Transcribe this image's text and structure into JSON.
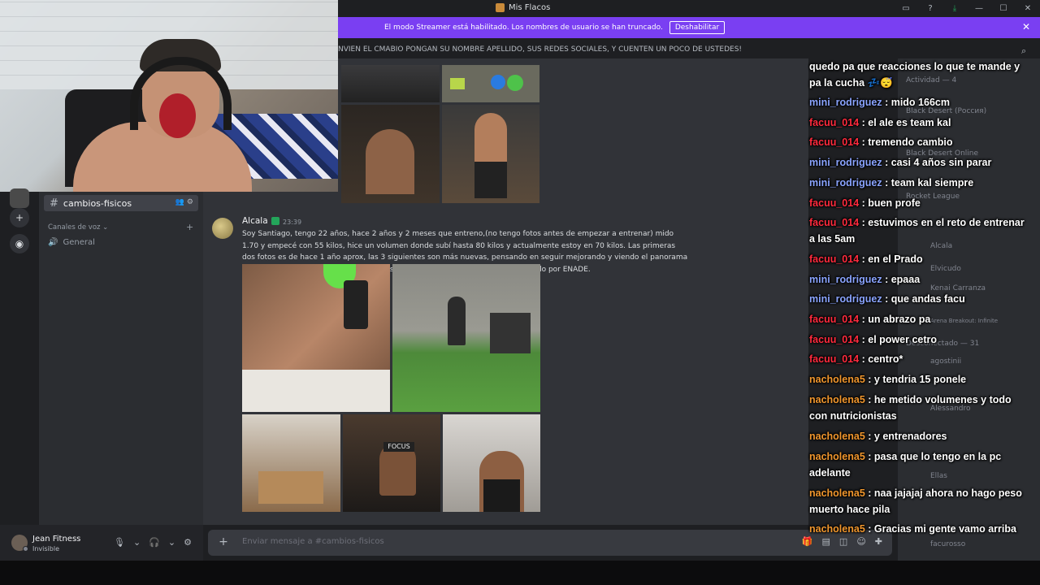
{
  "window": {
    "title": "Mis Flacos",
    "controls": [
      "inbox-icon",
      "help-icon",
      "download-icon",
      "minimize",
      "maximize",
      "close"
    ]
  },
  "streamer_banner": {
    "text": "El modo Streamer está habilitado. Los nombres de usuario se han truncado.",
    "button": "Deshabilitar"
  },
  "channel_topic": "NVIEN EL CMABIO PONGAN SU NOMBRE APELLIDO, SUS REDES SOCIALES, Y CUENTEN UN POCO DE USTEDES!",
  "sidebar": {
    "active_channel": "cambios-fisicos",
    "voice_header": "Canales de voz",
    "voice_channel": "General"
  },
  "user_panel": {
    "name": "Jean Fitness",
    "status": "Invisible"
  },
  "message": {
    "author": "Alcala",
    "time": "23:39",
    "text": "Soy Santiago, tengo 22 años, hace 2 años y 2 meses que entreno,(no tengo fotos antes de empezar a entrenar) mido 1.70 y empecé con 55 kilos, hice un volumen donde subí hasta 80 kilos y actualmente estoy en 70 kilos. Las primeras dos fotos es de hace 1 año aprox, las 3 siguientes son más nuevas, pensando en seguir mejorando y viendo el panorama para un próximo volumen. Actualmente soy entrenador de musculación certificado por ENADE."
  },
  "composer": {
    "placeholder": "Enviar mensaje a #cambios-fisicos"
  },
  "members": [
    {
      "name": "Actividad — 4"
    },
    {
      "name": "Black Desert (Россия)"
    },
    {
      "name": "Black Desert Online"
    },
    {
      "name": "Rocket League"
    },
    {
      "name": "Alcala"
    },
    {
      "name": "Elvicudo"
    },
    {
      "name": "Kenai Carranza"
    },
    {
      "name": "Arena Breakout: Infinite"
    },
    {
      "name": "Desconectado — 31"
    },
    {
      "name": "agostinii"
    },
    {
      "name": "Alessandro"
    },
    {
      "name": "Ellas"
    },
    {
      "name": "facurosso"
    }
  ],
  "stream_chat": [
    {
      "user": "",
      "text": "quedo pa que reacciones lo que te mande y pa la cucha 💤😴",
      "color": "#ffffff"
    },
    {
      "user": "mini_rodriguez",
      "text": "mido 166cm",
      "color": "#8aa4ff"
    },
    {
      "user": "facuu_014",
      "text": "el ale es team kal",
      "color": "#ff2a3d"
    },
    {
      "user": "facuu_014",
      "text": "tremendo cambio",
      "color": "#ff2a3d"
    },
    {
      "user": "mini_rodriguez",
      "text": "casi 4 años sin parar",
      "color": "#8aa4ff"
    },
    {
      "user": "mini_rodriguez",
      "text": "team kal siempre",
      "color": "#8aa4ff"
    },
    {
      "user": "facuu_014",
      "text": "buen profe",
      "color": "#ff2a3d"
    },
    {
      "user": "facuu_014",
      "text": "estuvimos en el reto de entrenar a las 5am",
      "color": "#ff2a3d"
    },
    {
      "user": "facuu_014",
      "text": "en el Prado",
      "color": "#ff2a3d"
    },
    {
      "user": "mini_rodriguez",
      "text": "epaaa",
      "color": "#8aa4ff"
    },
    {
      "user": "mini_rodriguez",
      "text": "que andas facu",
      "color": "#8aa4ff"
    },
    {
      "user": "facuu_014",
      "text": "un abrazo pa",
      "color": "#ff2a3d"
    },
    {
      "user": "facuu_014",
      "text": "el power cetro",
      "color": "#ff2a3d"
    },
    {
      "user": "facuu_014",
      "text": "centro*",
      "color": "#ff2a3d"
    },
    {
      "user": "nacholena5",
      "text": "y tendria 15 ponele",
      "color": "#f0962d"
    },
    {
      "user": "nacholena5",
      "text": "he metido volumenes y todo con nutricionistas",
      "color": "#f0962d"
    },
    {
      "user": "nacholena5",
      "text": "y entrenadores",
      "color": "#f0962d"
    },
    {
      "user": "nacholena5",
      "text": "pasa que lo tengo en la pc adelante",
      "color": "#f0962d"
    },
    {
      "user": "nacholena5",
      "text": "naa jajajaj ahora no hago peso muerto hace pila",
      "color": "#f0962d"
    },
    {
      "user": "nacholena5",
      "text": "Gracias mi gente vamo arriba",
      "color": "#f0962d"
    }
  ]
}
